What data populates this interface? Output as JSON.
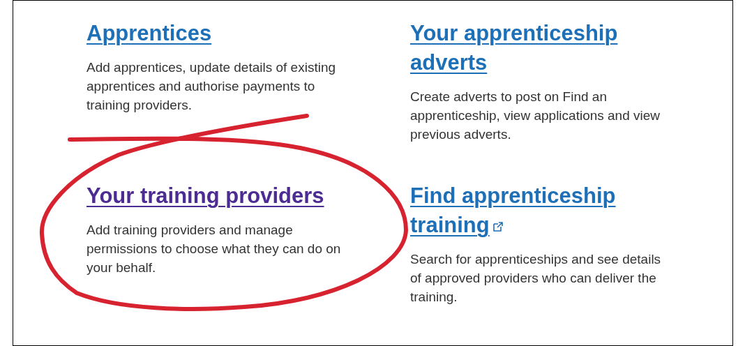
{
  "cards": [
    {
      "title": "Apprentices",
      "visited": false,
      "external": false,
      "circled": false,
      "description": "Add apprentices, update details of existing apprentices and authorise payments to training providers."
    },
    {
      "title": "Your apprenticeship adverts",
      "visited": false,
      "external": false,
      "circled": false,
      "description": "Create adverts to post on Find an apprenticeship, view applications and view previous adverts."
    },
    {
      "title": "Your training providers",
      "visited": true,
      "external": false,
      "circled": true,
      "description": "Add training providers and manage permissions to choose what they can do on your behalf."
    },
    {
      "title": "Find apprenticeship training",
      "visited": false,
      "external": true,
      "circled": false,
      "description": "Search for apprenticeships and see details of approved providers who can deliver the training."
    }
  ]
}
